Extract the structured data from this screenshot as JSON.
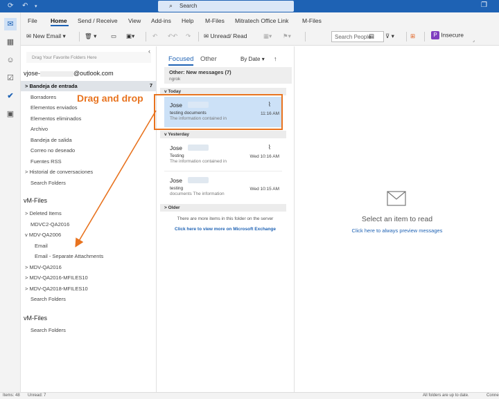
{
  "titlebar": {
    "search_placeholder": "Search",
    "icons": [
      "sync-icon",
      "undo-icon",
      "dropdown-icon",
      "search-icon",
      "restore-icon"
    ]
  },
  "ribbon": {
    "tabs": [
      "File",
      "Home",
      "Send / Receive",
      "View",
      "Add-ins",
      "Help",
      "M-Files",
      "Mitratech Office Link",
      "M-Files"
    ],
    "active_tab": "Home",
    "new_email": "New Email",
    "unread_read": "Unread/ Read",
    "search_people_placeholder": "Search People",
    "insecure": "Insecure",
    "insecure_badge": "P",
    "mfiles_badge": "M"
  },
  "folders": {
    "favorites_hint": "Drag Your Favorite Folders Here",
    "account_prefix": "jose-",
    "account_suffix": "@outlook.com",
    "account_folders": [
      {
        "label": "Bandeja de entrada",
        "count": "7",
        "selected": true,
        "expander": ">"
      },
      {
        "label": "Borradores"
      },
      {
        "label": "Elementos enviados"
      },
      {
        "label": "Elementos eliminados"
      },
      {
        "label": "Archivo"
      },
      {
        "label": "Bandeja de salida"
      },
      {
        "label": "Correo no deseado"
      },
      {
        "label": "Fuentes RSS"
      },
      {
        "label": "Historial de conversaciones",
        "expander": ">"
      },
      {
        "label": "Search Folders"
      }
    ],
    "mfiles_1": "M-Files",
    "mfiles_1_items": [
      {
        "label": "Deleted Items",
        "expander": ">"
      },
      {
        "label": "MDVC2-QA2016"
      },
      {
        "label": "MDV-QA2006",
        "expander": "v"
      },
      {
        "label": "Email",
        "indent": true
      },
      {
        "label": "Email - Separate Attachments",
        "indent": true
      },
      {
        "label": "MDV-QA2016",
        "expander": ">"
      },
      {
        "label": "MDV-QA2016-MFILES10",
        "expander": ">"
      },
      {
        "label": "MDV-QA2018-MFILES10",
        "expander": ">"
      },
      {
        "label": "Search Folders"
      }
    ],
    "mfiles_2": "M-Files",
    "mfiles_2_items": [
      {
        "label": "Search Folders"
      }
    ]
  },
  "messages": {
    "tab_focused": "Focused",
    "tab_other": "Other",
    "sort": "By Date",
    "new_messages_title": "Other: New messages (7)",
    "new_messages_sub": "ngrok",
    "group_today": "Today",
    "group_yesterday": "Yesterday",
    "group_older": "Older",
    "items": [
      {
        "sender": "Jose",
        "subject": "testing documents",
        "preview": "The information contained in",
        "time": "11:16 AM",
        "attachment": true
      },
      {
        "sender": "Jose",
        "subject": "Testing",
        "preview": "The information contained in",
        "time": "Wed 10:16 AM",
        "attachment": true
      },
      {
        "sender": "Jose",
        "subject": "testing",
        "preview": "documents  The information",
        "time": "Wed 10:15 AM",
        "attachment": false
      }
    ],
    "server_note": "There are more items in this folder on the server",
    "server_link": "Click here to view more on Microsoft Exchange"
  },
  "reading": {
    "title": "Select an item to read",
    "link": "Click here to always preview messages"
  },
  "status": {
    "items": "Items: 48",
    "unread": "Unread: 7",
    "sync": "All folders are up to date.",
    "connection": "Conne"
  },
  "annotation": {
    "label": "Drag and drop",
    "color": "#e8731f"
  }
}
